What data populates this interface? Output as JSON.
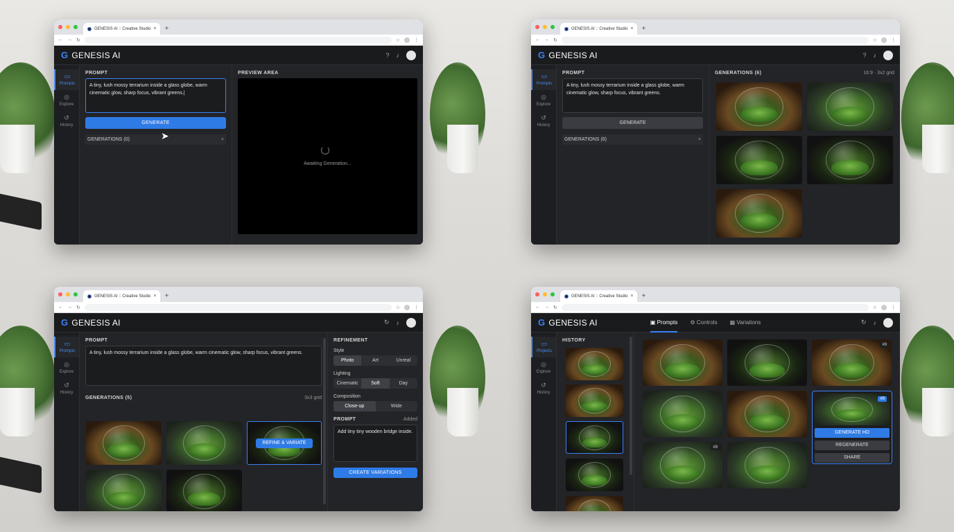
{
  "browser": {
    "tab_title_1": "GENESIS AI :: Creative Studio",
    "tab_title_2": "GENESIS AI :: Creative Studio",
    "tab_title_3": "GENESIS AI :: Creative Studio",
    "tab_title_4": "GENESIS AI :: Creative Studio",
    "new_tab": "+",
    "close": "×"
  },
  "app": {
    "logo_bold": "GENESIS",
    "logo_light": " AI",
    "logo_glyph": "G"
  },
  "rail": {
    "prompts": "Prompts",
    "explore": "Explore",
    "history": "History",
    "projects": "Projects"
  },
  "screen1": {
    "prompt_label": "PROMPT",
    "prompt_text": "A tiny, lush mossy terrarium inside a glass globe, warm cinematic glow, sharp focus, vibrant greens.|",
    "generate": "GENERATE",
    "generations": "GENERATIONS (0)",
    "plus": "+",
    "preview_label": "PREVIEW AREA",
    "awaiting": "Awaiting Generation..."
  },
  "screen2": {
    "prompt_label": "PROMPT",
    "prompt_text": "A tiny, lush mossy terrarium inside a glass globe, warm cinematic glow, sharp focus, vibrant greens.",
    "generate": "GENERATE",
    "generations_left": "GENERATIONS (6)",
    "plus": "+",
    "generations_label": "GENERATIONS (6)",
    "grid_info": "16:9 · 3x2 grid"
  },
  "screen3": {
    "prompt_label": "PROMPT",
    "prompt_text": "A tiny, lush mossy terrarium inside a glass globe, warm cinematic glow, sharp focus, vibrant greens.",
    "generations": "GENERATIONS (5)",
    "grid_info": "3x3 grid",
    "refine": "REFINE & VARIATE",
    "refinement": "REFINEMENT",
    "style": "Style",
    "style_opts": [
      "Photo",
      "Art",
      "Unreal"
    ],
    "lighting": "Lighting",
    "lighting_opts": [
      "Cinematic",
      "Soft",
      "Day"
    ],
    "composition": "Composition",
    "composition_opts": [
      "Close-up",
      "Wide"
    ],
    "prompt2_label": "PROMPT",
    "added": "Added",
    "prompt2_text": "Add tiny tiny wooden bridge inside.",
    "create": "CREATE VARIATIONS"
  },
  "screen4": {
    "nav": [
      "Prompts",
      "Controls",
      "Variations"
    ],
    "history": "HISTORY",
    "badge_a": "#9",
    "badge_b": "#9",
    "badge_c": "#9",
    "generate_hd": "GENERATE HD",
    "regenerate": "REGENERATE",
    "share": "SHARE"
  },
  "icons": {
    "folder": "folder-icon",
    "compass": "compass-icon",
    "history": "history-icon",
    "help": "help-icon",
    "bell": "bell-icon",
    "star": "star-icon"
  }
}
